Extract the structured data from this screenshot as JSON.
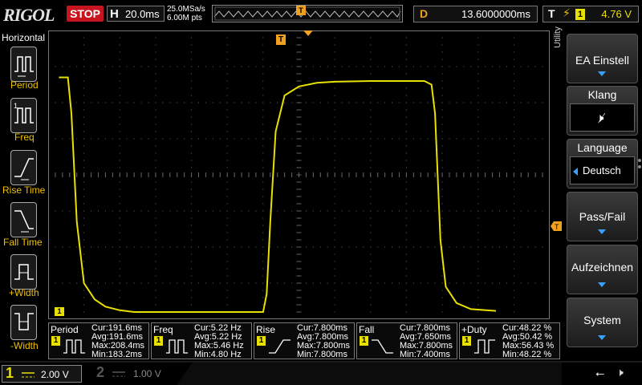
{
  "header": {
    "brand": "RIGOL",
    "run_state": "STOP",
    "timebase_key": "H",
    "timebase_value": "20.0ms",
    "sample_rate": "25.0MSa/s",
    "memory_depth": "6.00M pts",
    "trigger_marker": "T",
    "delay_key": "D",
    "delay_value": "13.6000000ms",
    "trigger_key": "T",
    "trigger_channel": "1",
    "trigger_level": "4.76 V"
  },
  "left_panel": {
    "title": "Horizontal",
    "items": [
      {
        "label": "Period",
        "icon": "period-icon"
      },
      {
        "label": "Freq",
        "icon": "frequency-icon"
      },
      {
        "label": "Rise Time",
        "icon": "rise-time-icon"
      },
      {
        "label": "Fall Time",
        "icon": "fall-time-icon"
      },
      {
        "label": "+Width",
        "icon": "positive-width-icon"
      },
      {
        "label": "-Width",
        "icon": "negative-width-icon"
      }
    ]
  },
  "right_panel": {
    "menu_title": "Utility",
    "buttons": [
      {
        "label": "EA Einstell"
      },
      {
        "label": "Klang"
      },
      {
        "label": "Language",
        "value": "Deutsch"
      },
      {
        "label": "Pass/Fail"
      },
      {
        "label": "Aufzeichnen"
      },
      {
        "label": "System"
      }
    ]
  },
  "measurements": [
    {
      "name": "Period",
      "channel": "1",
      "cur": "Cur:191.6ms",
      "avg": "Avg:191.6ms",
      "max": "Max:208.4ms",
      "min": "Min:183.2ms"
    },
    {
      "name": "Freq",
      "channel": "1",
      "cur": "Cur:5.22 Hz",
      "avg": "Avg:5.22 Hz",
      "max": "Max:5.46 Hz",
      "min": "Min:4.80 Hz"
    },
    {
      "name": "Rise",
      "channel": "1",
      "cur": "Cur:7.800ms",
      "avg": "Avg:7.800ms",
      "max": "Max:7.800ms",
      "min": "Min:7.800ms"
    },
    {
      "name": "Fall",
      "channel": "1",
      "cur": "Cur:7.800ms",
      "avg": "Avg:7.650ms",
      "max": "Max:7.800ms",
      "min": "Min:7.400ms"
    },
    {
      "name": "+Duty",
      "channel": "1",
      "cur": "Cur:48.22 %",
      "avg": "Avg:50.42 %",
      "max": "Max:56.43 %",
      "min": "Min:48.22 %"
    }
  ],
  "channels": [
    {
      "number": "1",
      "scale": "2.00 V",
      "active": true
    },
    {
      "number": "2",
      "scale": "1.00 V",
      "active": false
    }
  ],
  "colors": {
    "ch1": "#e8e000",
    "trigger": "#f0a020",
    "stop": "#c8141e",
    "accent": "#3aa0ff"
  },
  "chart_data": {
    "type": "line",
    "series": [
      {
        "name": "",
        "x_div": [
          0.3,
          0.55,
          0.65,
          0.8,
          1.0,
          1.3,
          1.6,
          2.0,
          2.4,
          3.0,
          3.5,
          4.5,
          5.6,
          6.0,
          6.1,
          6.2,
          6.35,
          6.6,
          7.0,
          7.5,
          8.0,
          9.0,
          10.5,
          10.7,
          10.8,
          10.95,
          11.1,
          11.4,
          11.8,
          12.5
        ],
        "y_div": [
          6.5,
          6.5,
          5.5,
          2.5,
          0.8,
          0.35,
          0.15,
          0.05,
          0.0,
          0.0,
          0.0,
          0.0,
          0.0,
          0.0,
          0.5,
          2.5,
          5.0,
          6.0,
          6.25,
          6.35,
          6.38,
          6.4,
          6.4,
          6.3,
          5.5,
          2.0,
          0.7,
          0.25,
          0.08,
          0.03
        ]
      }
    ],
    "grid": true,
    "x_divisions": 14,
    "y_divisions": 8
  }
}
